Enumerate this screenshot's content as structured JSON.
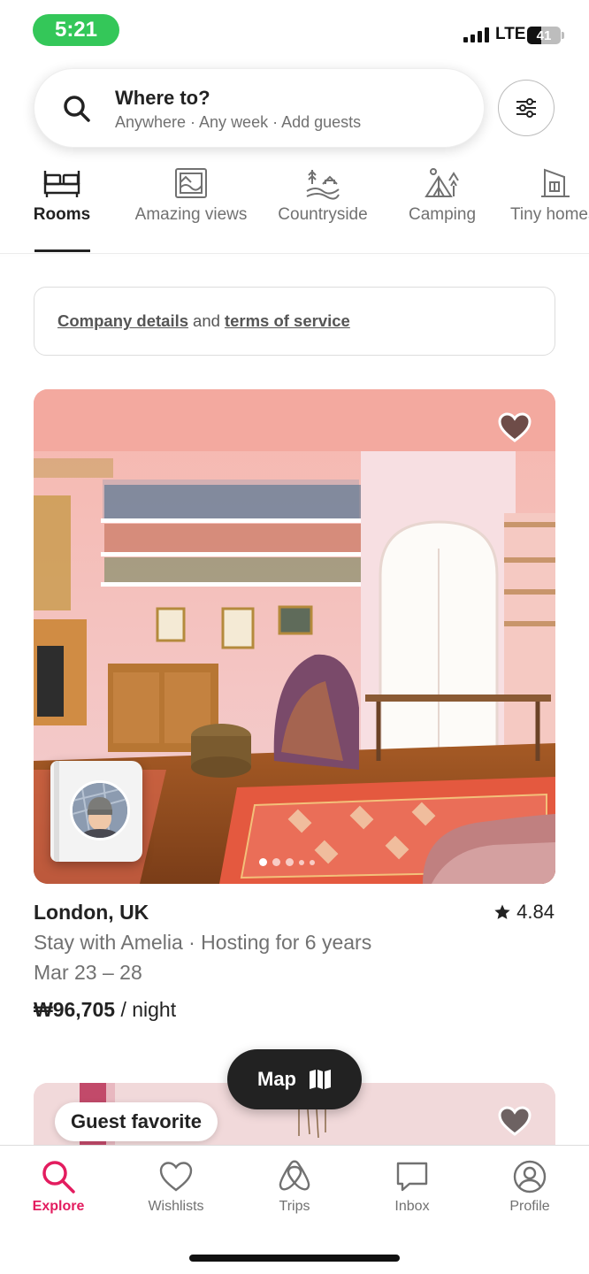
{
  "status_bar": {
    "time": "5:21",
    "network": "LTE",
    "battery": "41",
    "battery_level": 0.41
  },
  "search": {
    "title": "Where to?",
    "subtitle": "Anywhere · Any week · Add guests",
    "icon": "search-icon",
    "filter_icon": "filter-icon"
  },
  "categories": [
    {
      "label": "Rooms",
      "icon": "bed-icon",
      "active": true
    },
    {
      "label": "Amazing views",
      "icon": "picture-icon",
      "active": false
    },
    {
      "label": "Countryside",
      "icon": "countryside-icon",
      "active": false
    },
    {
      "label": "Camping",
      "icon": "tent-icon",
      "active": false
    },
    {
      "label": "Tiny homes",
      "icon": "tiny-home-icon",
      "active": false
    }
  ],
  "notice": {
    "link1": "Company details",
    "middle": "and",
    "link2": "terms of service"
  },
  "listing": {
    "title": "London, UK",
    "rating": "4.84",
    "host": "Stay with Amelia · Hosting for 6 years",
    "dates": "Mar 23 – 28",
    "price": "₩96,705",
    "price_unit": "/ night",
    "photo_index": 1,
    "photo_count": 5,
    "wishlisted": false
  },
  "listing2": {
    "badge": "Guest favorite"
  },
  "map_button": {
    "label": "Map",
    "icon": "map-icon"
  },
  "nav": [
    {
      "label": "Explore",
      "icon": "search-icon",
      "active": true
    },
    {
      "label": "Wishlists",
      "icon": "heart-icon",
      "active": false
    },
    {
      "label": "Trips",
      "icon": "airbnb-logo-icon",
      "active": false
    },
    {
      "label": "Inbox",
      "icon": "chat-icon",
      "active": false
    },
    {
      "label": "Profile",
      "icon": "user-circle-icon",
      "active": false
    }
  ],
  "colors": {
    "accent": "#e31c5f",
    "text": "#222222",
    "muted": "#717171",
    "status_green": "#34c759"
  }
}
